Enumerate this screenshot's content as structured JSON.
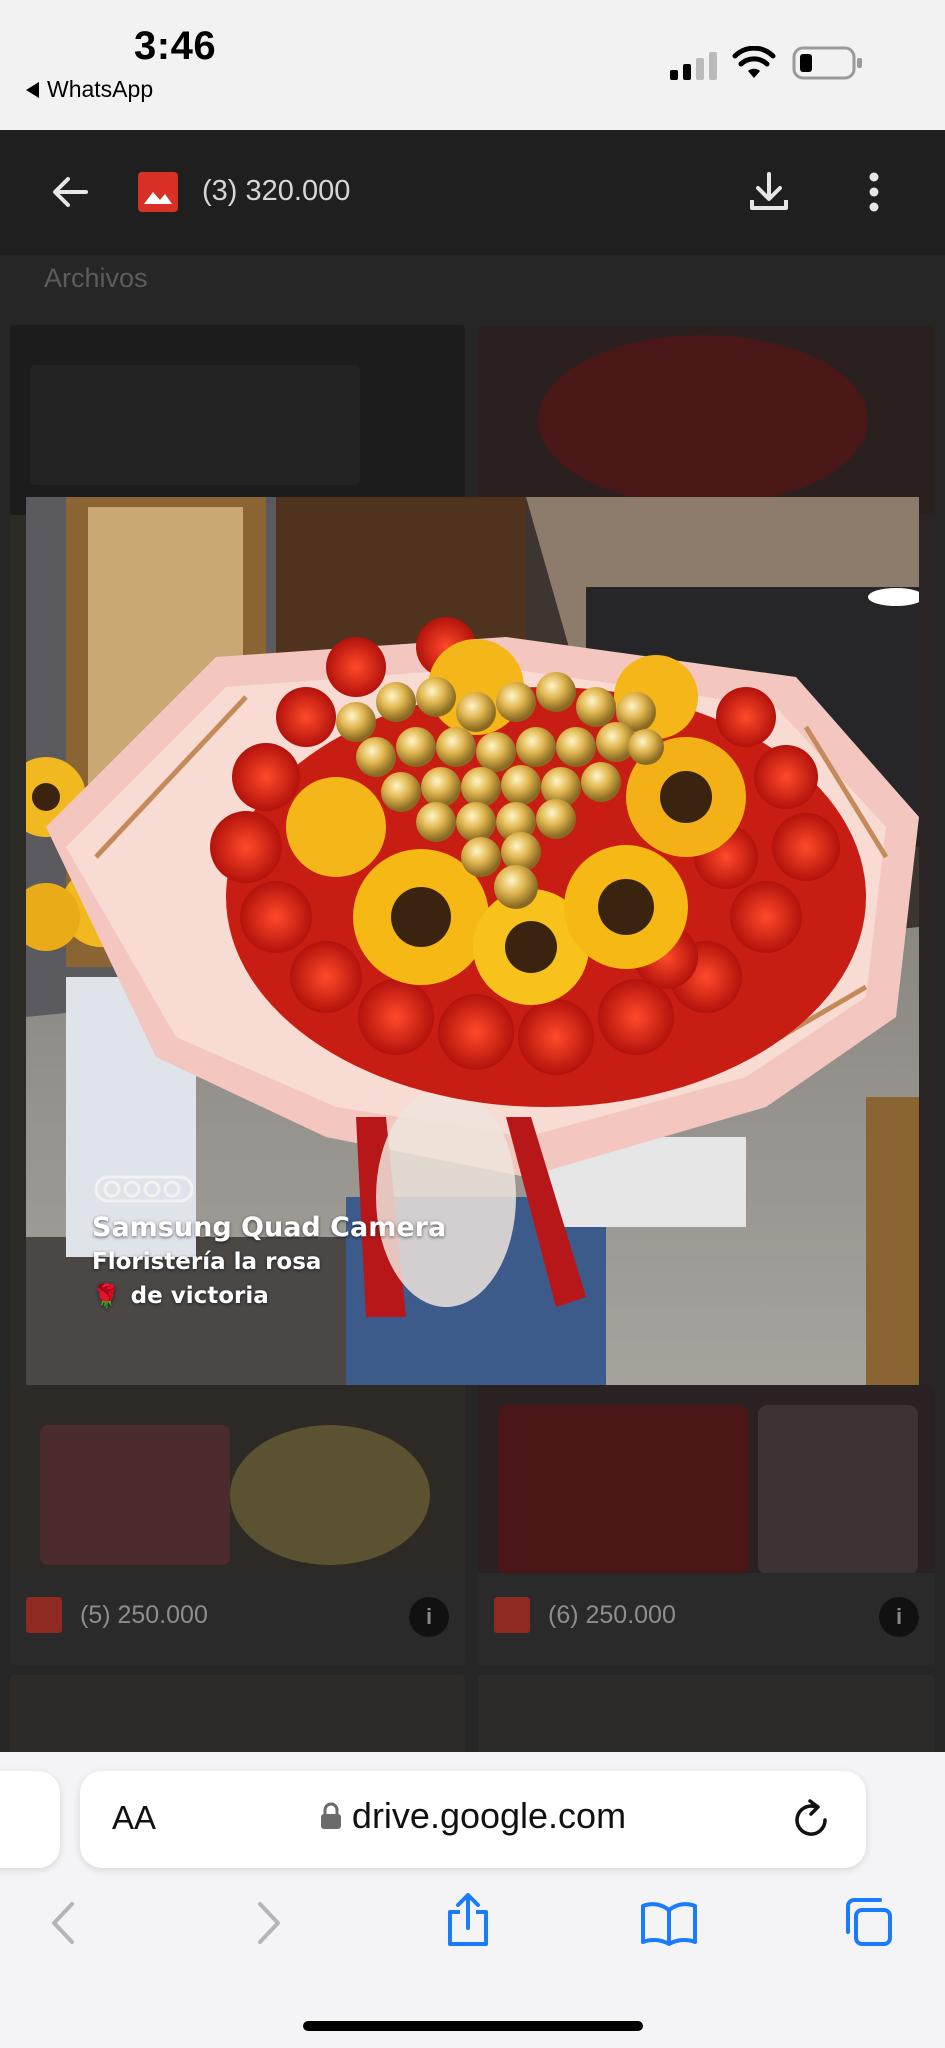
{
  "status_bar": {
    "time": "3:46",
    "back_app": "WhatsApp"
  },
  "toolbar": {
    "title": "(3) 320.000"
  },
  "background": {
    "section_label": "Archivos",
    "files": [
      {
        "label": "(5) 250.000"
      },
      {
        "label": "(6) 250.000"
      }
    ]
  },
  "photo": {
    "watermark_line1": "Samsung Quad Camera",
    "watermark_line2": "Floristería la rosa",
    "watermark_line3": "de victoria",
    "rose_emoji": "🌹"
  },
  "safari": {
    "text_size_label": "AA",
    "url": "drive.google.com"
  },
  "colors": {
    "drive_image_red": "#d93025",
    "ios_blue": "#1a7bff"
  }
}
